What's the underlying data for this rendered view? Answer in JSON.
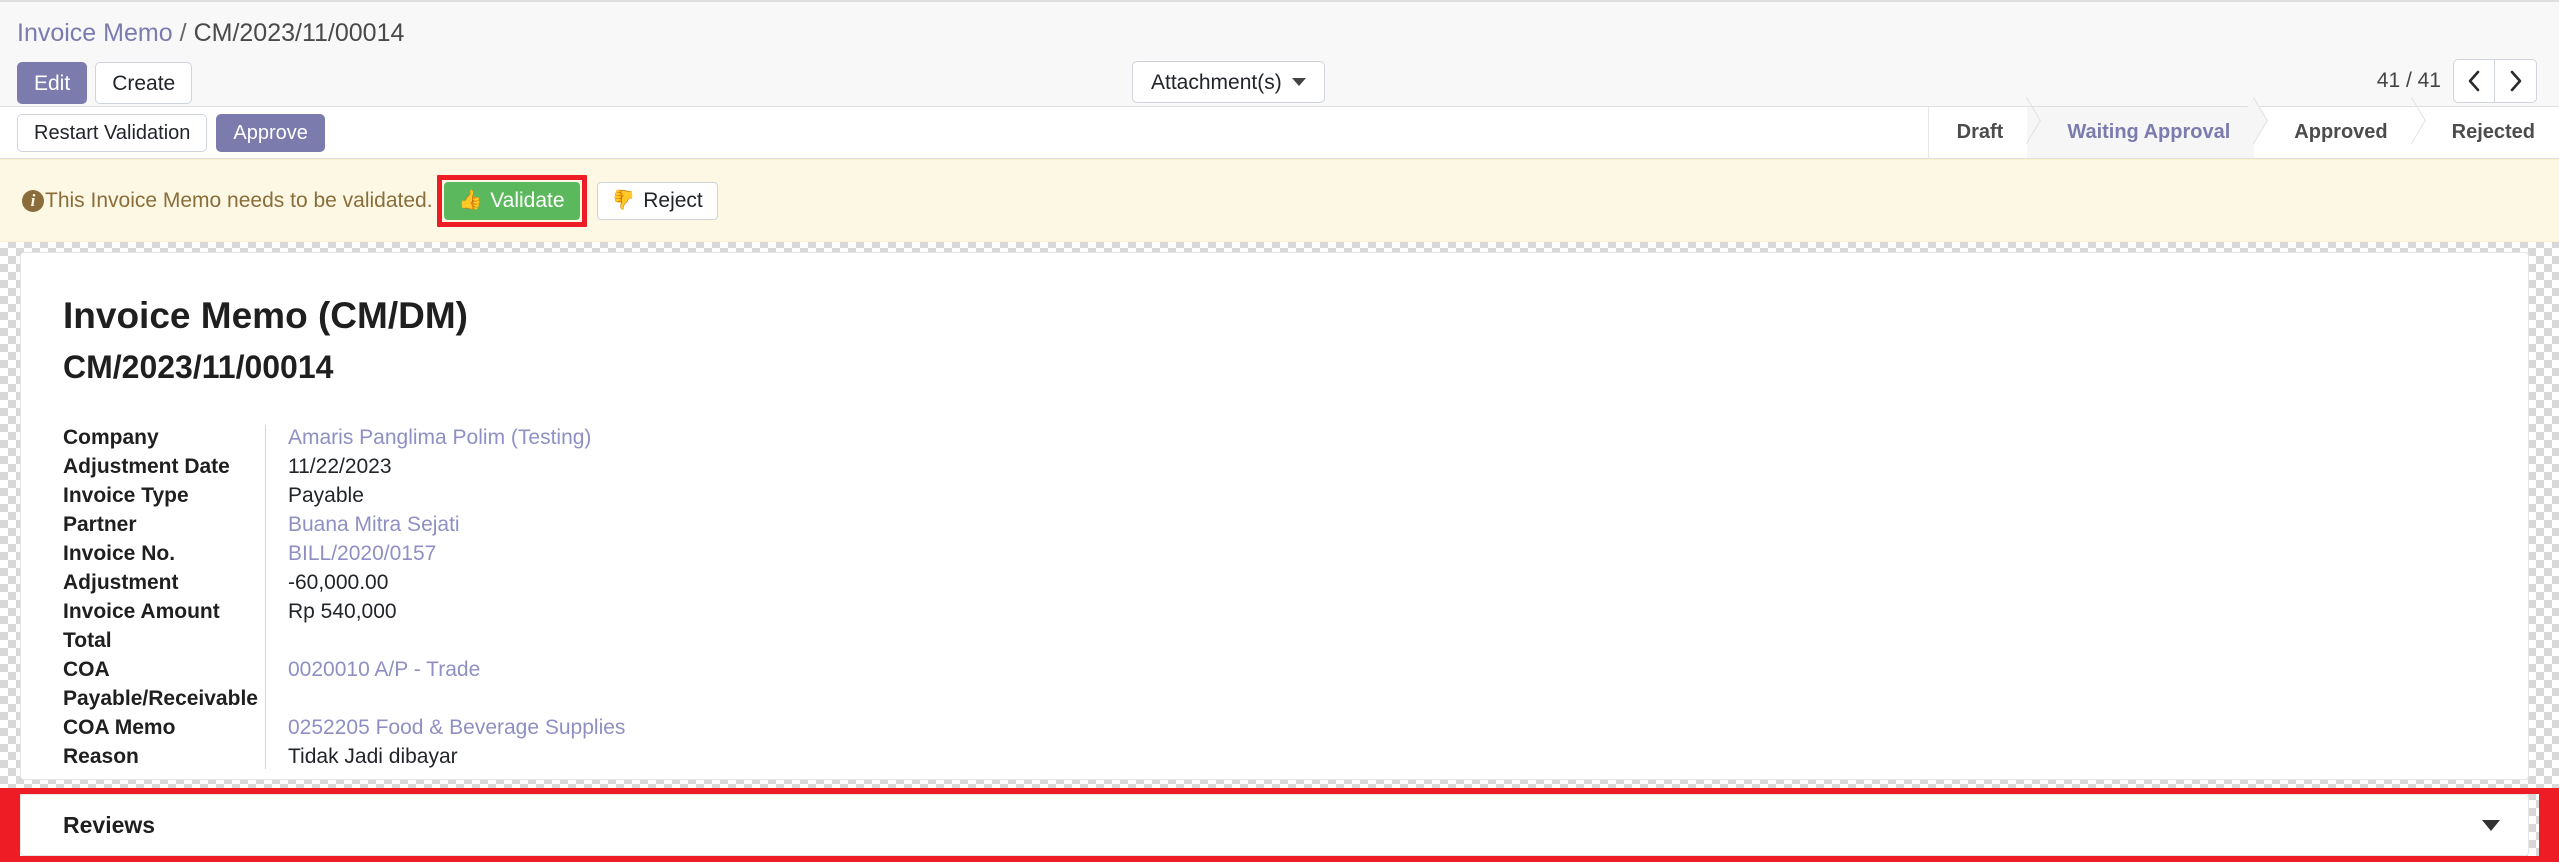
{
  "breadcrumb": {
    "root": "Invoice Memo",
    "separator": "/",
    "current": "CM/2023/11/00014"
  },
  "control_panel": {
    "edit_label": "Edit",
    "create_label": "Create",
    "attachments_label": "Attachment(s)",
    "attachments_caret_icon": "caret-down-icon",
    "pager_count": "41 / 41",
    "pager_prev_icon": "chevron-left-icon",
    "pager_next_icon": "chevron-right-icon"
  },
  "action_bar": {
    "restart_validation_label": "Restart Validation",
    "approve_label": "Approve"
  },
  "statusbar": {
    "stages": [
      {
        "label": "Draft",
        "active": false
      },
      {
        "label": "Waiting Approval",
        "active": true
      },
      {
        "label": "Approved",
        "active": false
      },
      {
        "label": "Rejected",
        "active": false
      }
    ],
    "active_color": "#7c7bad"
  },
  "alert": {
    "icon": "info-circle-icon",
    "message": "This Invoice Memo needs to be validated.",
    "validate_label": "Validate",
    "validate_icon": "thumbs-up-icon",
    "reject_label": "Reject",
    "reject_icon": "thumbs-down-icon",
    "validate_color": "#5cb85c",
    "highlight_color": "#ee1c24",
    "background_color": "#fcf8e3"
  },
  "record": {
    "title": "Invoice Memo (CM/DM)",
    "name": "CM/2023/11/00014",
    "fields": [
      {
        "label": "Company",
        "value": "Amaris Panglima Polim (Testing)",
        "is_link": true
      },
      {
        "label": "Adjustment Date",
        "value": "11/22/2023",
        "is_link": false
      },
      {
        "label": "Invoice Type",
        "value": "Payable",
        "is_link": false
      },
      {
        "label": "Partner",
        "value": "Buana Mitra Sejati",
        "is_link": true
      },
      {
        "label": "Invoice No.",
        "value": "BILL/2020/0157",
        "is_link": true
      },
      {
        "label": "Adjustment",
        "value": "-60,000.00",
        "is_link": false
      },
      {
        "label": "Invoice Amount Total",
        "value": "Rp 540,000",
        "is_link": false
      },
      {
        "label": "COA Payable/Receivable",
        "value": "0020010 A/P - Trade",
        "is_link": true
      },
      {
        "label": "COA Memo",
        "value": "0252205 Food & Beverage Supplies",
        "is_link": true
      },
      {
        "label": "Reason",
        "value": "Tidak Jadi dibayar",
        "is_link": false
      }
    ]
  },
  "reviews": {
    "title": "Reviews",
    "caret_icon": "caret-down-icon",
    "highlight_color": "#ee1c24"
  }
}
